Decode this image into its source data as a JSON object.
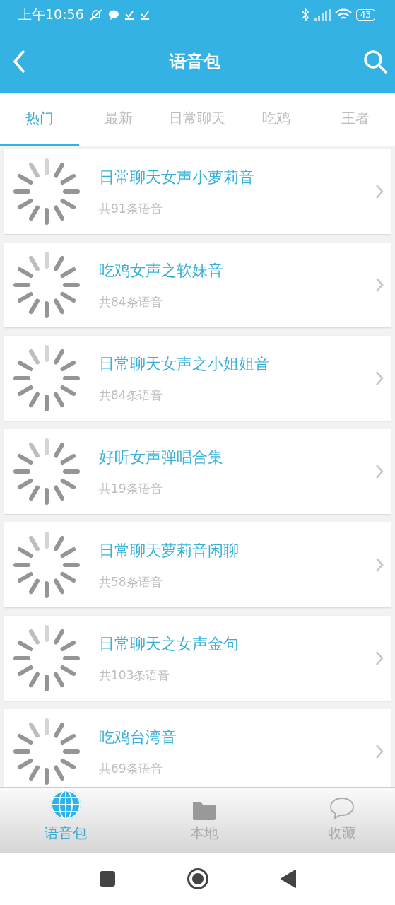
{
  "status_bar": {
    "time": "上午10:56",
    "battery": "43"
  },
  "app_bar": {
    "title": "语音包"
  },
  "tabs": [
    {
      "label": "热门",
      "selected": true
    },
    {
      "label": "最新",
      "selected": false
    },
    {
      "label": "日常聊天",
      "selected": false
    },
    {
      "label": "吃鸡",
      "selected": false
    },
    {
      "label": "王者",
      "selected": false
    }
  ],
  "packs": [
    {
      "title": "日常聊天女声小萝莉音",
      "count": "共91条语音"
    },
    {
      "title": "吃鸡女声之软妹音",
      "count": "共84条语音"
    },
    {
      "title": "日常聊天女声之小姐姐音",
      "count": "共84条语音"
    },
    {
      "title": "好听女声弹唱合集",
      "count": "共19条语音"
    },
    {
      "title": "日常聊天萝莉音闲聊",
      "count": "共58条语音"
    },
    {
      "title": "日常聊天之女声金句",
      "count": "共103条语音"
    },
    {
      "title": "吃鸡台湾音",
      "count": "共69条语音"
    }
  ],
  "bottom_nav": [
    {
      "label": "语音包",
      "kind": "globe",
      "selected": true
    },
    {
      "label": "本地",
      "kind": "folder",
      "selected": false
    },
    {
      "label": "收藏",
      "kind": "chat",
      "selected": false
    }
  ]
}
